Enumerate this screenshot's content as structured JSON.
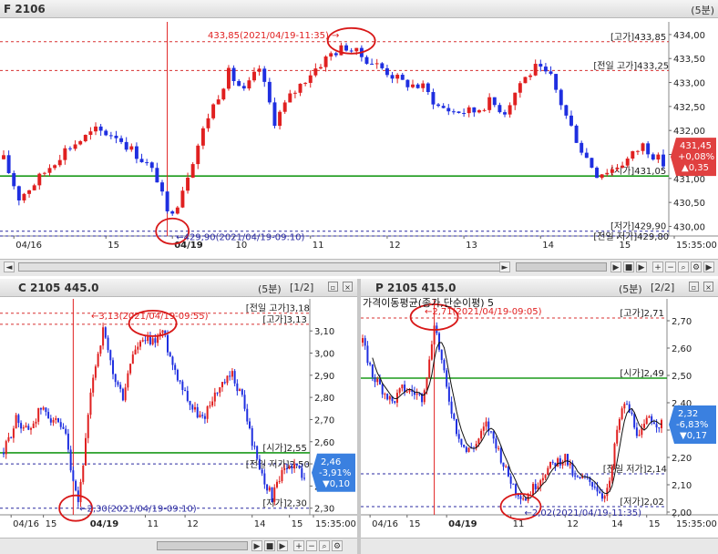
{
  "colors": {
    "up": "#e02020",
    "down": "#1f2fe0",
    "green": "#1a9a1a",
    "red_dash": "#d83030",
    "blue_dash": "#2a2aa0",
    "badge": "#e04040",
    "badge_blue": "#3a80e0",
    "circle": "#d81818"
  },
  "icons": [
    "close-icon",
    "restore-icon",
    "zoom-in-icon",
    "zoom-out-icon",
    "search-icon",
    "wrench-icon",
    "play-icon",
    "stop-icon"
  ],
  "panels": {
    "futures": {
      "title": "F 2106",
      "timeframe": "(5분)",
      "right": "",
      "left_arrow": "◄",
      "right_arrow": "►"
    },
    "call": {
      "title": "C 2105 445.0",
      "timeframe": "(5분)",
      "page": "[1/2]"
    },
    "put": {
      "title": "P 2105 415.0",
      "timeframe": "(5분)",
      "page": "[2/2]",
      "ma_label": "가격이동평균(종가,단순이평) 5"
    }
  },
  "chart_data": [
    {
      "type": "candlestick",
      "name": "F 2106",
      "ylim": [
        429.8,
        434.15
      ],
      "y_ticks": [
        {
          "v": 434.0,
          "label": "434,00"
        },
        {
          "v": 433.5,
          "label": "433,50"
        },
        {
          "v": 433.0,
          "label": "433,00"
        },
        {
          "v": 432.5,
          "label": "432,50"
        },
        {
          "v": 432.0,
          "label": "432,00"
        },
        {
          "v": 431.5,
          "label": "431,50"
        },
        {
          "v": 431.0,
          "label": "431,00"
        },
        {
          "v": 430.5,
          "label": "430,50"
        },
        {
          "v": 430.0,
          "label": "430,00"
        }
      ],
      "x_labels": [
        {
          "i": 2,
          "label": "04/16"
        },
        {
          "i": 20,
          "label": "15"
        },
        {
          "i": 33,
          "label": "04/19"
        },
        {
          "i": 45,
          "label": "10"
        },
        {
          "i": 60,
          "label": "11"
        },
        {
          "i": 75,
          "label": "12"
        },
        {
          "i": 90,
          "label": "13"
        },
        {
          "i": 105,
          "label": "14"
        },
        {
          "i": 120,
          "label": "15"
        },
        {
          "i": 132,
          "label": "15:35:00"
        }
      ],
      "n": 130,
      "anchors": [
        [
          0,
          431.4
        ],
        [
          3,
          430.6
        ],
        [
          6,
          430.9
        ],
        [
          12,
          431.6
        ],
        [
          18,
          432.0
        ],
        [
          22,
          431.9
        ],
        [
          28,
          431.3
        ],
        [
          30,
          431.0
        ],
        [
          32,
          430.25
        ],
        [
          34,
          430.5
        ],
        [
          36,
          431.1
        ],
        [
          40,
          432.3
        ],
        [
          44,
          433.2
        ],
        [
          47,
          432.8
        ],
        [
          50,
          433.3
        ],
        [
          53,
          432.2
        ],
        [
          56,
          432.7
        ],
        [
          60,
          433.2
        ],
        [
          64,
          433.6
        ],
        [
          67,
          433.75
        ],
        [
          70,
          433.55
        ],
        [
          74,
          433.3
        ],
        [
          78,
          433.0
        ],
        [
          82,
          432.9
        ],
        [
          85,
          432.5
        ],
        [
          88,
          432.4
        ],
        [
          92,
          432.4
        ],
        [
          95,
          432.6
        ],
        [
          98,
          432.4
        ],
        [
          101,
          433.0
        ],
        [
          104,
          433.3
        ],
        [
          107,
          433.1
        ],
        [
          110,
          432.3
        ],
        [
          113,
          431.6
        ],
        [
          116,
          431.1
        ],
        [
          119,
          431.2
        ],
        [
          122,
          431.4
        ],
        [
          125,
          431.7
        ],
        [
          127,
          431.5
        ],
        [
          129,
          431.3
        ]
      ],
      "markers": {
        "high_vline_i": 32,
        "high_label": "433,85(2021/04/19-11:35)",
        "high_v": 433.85,
        "high_i": 68,
        "low_label": "429,90(2021/04/19-09:10)",
        "low_v": 429.9,
        "low_i": 33
      },
      "levels": [
        {
          "v": 433.85,
          "label": "[고가]433,85",
          "color": "red_dash"
        },
        {
          "v": 433.25,
          "label": "[전일 고가]433,25",
          "color": "red_dash"
        },
        {
          "v": 431.05,
          "label": "[시가]431,05",
          "color": "green"
        },
        {
          "v": 429.9,
          "label": "[저가]429,90",
          "color": "blue_dash"
        },
        {
          "v": 429.8,
          "label": "[전일 저가]429,80",
          "color": "blue_dash"
        }
      ],
      "badge": {
        "value": "431,45",
        "change_pct": "+0,08%",
        "change": "▲0,35",
        "v": 431.45
      }
    },
    {
      "type": "candlestick",
      "name": "C 2105 445.0",
      "ylim": [
        2.27,
        3.22
      ],
      "y_ticks": [
        {
          "v": 3.1,
          "label": "3,10"
        },
        {
          "v": 3.0,
          "label": "3,00"
        },
        {
          "v": 2.9,
          "label": "2,90"
        },
        {
          "v": 2.8,
          "label": "2,80"
        },
        {
          "v": 2.7,
          "label": "2,70"
        },
        {
          "v": 2.6,
          "label": "2,60"
        },
        {
          "v": 2.5,
          "label": "2,50"
        },
        {
          "v": 2.4,
          "label": "2,40"
        },
        {
          "v": 2.3,
          "label": "2,30"
        }
      ],
      "x_labels": [
        {
          "i": 3,
          "label": "04/16"
        },
        {
          "i": 16,
          "label": "15"
        },
        {
          "i": 34,
          "label": "04/19"
        },
        {
          "i": 57,
          "label": "11"
        },
        {
          "i": 73,
          "label": "12"
        },
        {
          "i": 100,
          "label": "14"
        },
        {
          "i": 115,
          "label": "15"
        },
        {
          "i": 132,
          "label": "15:35:00"
        }
      ],
      "n": 122,
      "anchors": [
        [
          0,
          2.55
        ],
        [
          5,
          2.7
        ],
        [
          10,
          2.65
        ],
        [
          15,
          2.75
        ],
        [
          20,
          2.7
        ],
        [
          25,
          2.62
        ],
        [
          28,
          2.4
        ],
        [
          30,
          2.32
        ],
        [
          33,
          2.6
        ],
        [
          36,
          2.9
        ],
        [
          40,
          3.1
        ],
        [
          44,
          2.9
        ],
        [
          48,
          2.8
        ],
        [
          52,
          3.0
        ],
        [
          56,
          3.05
        ],
        [
          60,
          3.05
        ],
        [
          64,
          3.1
        ],
        [
          68,
          2.95
        ],
        [
          72,
          2.85
        ],
        [
          76,
          2.75
        ],
        [
          80,
          2.7
        ],
        [
          84,
          2.8
        ],
        [
          88,
          2.85
        ],
        [
          92,
          2.9
        ],
        [
          96,
          2.8
        ],
        [
          100,
          2.6
        ],
        [
          104,
          2.45
        ],
        [
          108,
          2.35
        ],
        [
          112,
          2.45
        ],
        [
          116,
          2.5
        ],
        [
          120,
          2.46
        ]
      ],
      "markers": {
        "high_vline_i": 28,
        "high_label": "3,13(2021/04/19-09:55)",
        "high_v": 3.13,
        "high_i": 60,
        "low_label": "2,30(2021/04/19-09:10)",
        "low_v": 2.3,
        "low_i": 29
      },
      "levels": [
        {
          "v": 3.18,
          "label": "[전일 고가]3,18",
          "color": "red_dash"
        },
        {
          "v": 3.13,
          "label": "[고가]3,13",
          "color": "red_dash"
        },
        {
          "v": 2.55,
          "label": "[시가]2,55",
          "color": "green"
        },
        {
          "v": 2.5,
          "label": "[전일 저가]2,50",
          "color": "blue_dash"
        },
        {
          "v": 2.3,
          "label": "[저가]2,30",
          "color": "blue_dash"
        }
      ],
      "badge": {
        "value": "2,46",
        "change_pct": "-3,91%",
        "change": "▼0,10",
        "v": 2.46
      }
    },
    {
      "type": "candlestick",
      "name": "P 2105 415.0",
      "ylim": [
        1.99,
        2.76
      ],
      "y_ticks": [
        {
          "v": 2.7,
          "label": "2,70"
        },
        {
          "v": 2.6,
          "label": "2,60"
        },
        {
          "v": 2.5,
          "label": "2,50"
        },
        {
          "v": 2.4,
          "label": "2,40"
        },
        {
          "v": 2.3,
          "label": "2,30"
        },
        {
          "v": 2.2,
          "label": "2,20"
        },
        {
          "v": 2.1,
          "label": "2,10"
        },
        {
          "v": 2.0,
          "label": "2,00"
        }
      ],
      "x_labels": [
        {
          "i": 3,
          "label": "04/16"
        },
        {
          "i": 18,
          "label": "15"
        },
        {
          "i": 34,
          "label": "04/19"
        },
        {
          "i": 60,
          "label": "11"
        },
        {
          "i": 82,
          "label": "12"
        },
        {
          "i": 100,
          "label": "14"
        },
        {
          "i": 115,
          "label": "15"
        },
        {
          "i": 132,
          "label": "15:35:00"
        }
      ],
      "n": 122,
      "anchors": [
        [
          0,
          2.62
        ],
        [
          4,
          2.5
        ],
        [
          8,
          2.45
        ],
        [
          12,
          2.4
        ],
        [
          16,
          2.45
        ],
        [
          20,
          2.44
        ],
        [
          24,
          2.42
        ],
        [
          27,
          2.55
        ],
        [
          29,
          2.7
        ],
        [
          31,
          2.6
        ],
        [
          34,
          2.45
        ],
        [
          38,
          2.3
        ],
        [
          42,
          2.22
        ],
        [
          46,
          2.25
        ],
        [
          50,
          2.32
        ],
        [
          54,
          2.25
        ],
        [
          58,
          2.15
        ],
        [
          62,
          2.08
        ],
        [
          66,
          2.05
        ],
        [
          70,
          2.1
        ],
        [
          74,
          2.15
        ],
        [
          78,
          2.18
        ],
        [
          82,
          2.2
        ],
        [
          86,
          2.12
        ],
        [
          90,
          2.12
        ],
        [
          94,
          2.1
        ],
        [
          97,
          2.06
        ],
        [
          100,
          2.1
        ],
        [
          103,
          2.3
        ],
        [
          106,
          2.4
        ],
        [
          109,
          2.35
        ],
        [
          112,
          2.27
        ],
        [
          116,
          2.35
        ],
        [
          120,
          2.32
        ]
      ],
      "markers": {
        "high_vline_i": 29,
        "high_label": "2,71(2021/04/19-09:05)",
        "high_v": 2.71,
        "high_i": 29,
        "low_label": "2,02(2021/04/19-11:35)",
        "low_v": 2.02,
        "low_i": 64
      },
      "levels": [
        {
          "v": 2.71,
          "label": "[고가]2,71",
          "color": "red_dash"
        },
        {
          "v": 2.49,
          "label": "[시가]2,49",
          "color": "green"
        },
        {
          "v": 2.14,
          "label": "[전일 저가]2,14",
          "color": "blue_dash"
        },
        {
          "v": 2.02,
          "label": "[저가]2,02",
          "color": "blue_dash"
        }
      ],
      "badge": {
        "value": "2,32",
        "change_pct": "-6,83%",
        "change": "▼0,17",
        "v": 2.32
      }
    }
  ]
}
